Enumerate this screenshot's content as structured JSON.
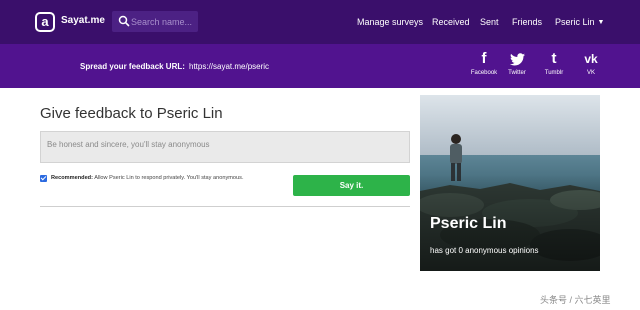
{
  "nav": {
    "brand": "Sayat.me",
    "search_placeholder": "Search name...",
    "links": {
      "manage_surveys": "Manage surveys",
      "received": "Received",
      "sent": "Sent",
      "friends": "Friends",
      "user": "Pseric Lin"
    }
  },
  "share": {
    "label": "Spread your feedback URL:",
    "url": "https://sayat.me/pseric",
    "networks": [
      {
        "label": "Facebook",
        "icon": "facebook-icon"
      },
      {
        "label": "Twitter",
        "icon": "twitter-icon"
      },
      {
        "label": "Tumblr",
        "icon": "tumblr-icon"
      },
      {
        "label": "VK",
        "icon": "vk-icon"
      }
    ]
  },
  "form": {
    "title": "Give feedback to Pseric Lin",
    "feedback_value": "",
    "feedback_placeholder": "Be honest and sincere, you'll stay anonymous",
    "recommended_checked": true,
    "recommended_bold": "Recommended:",
    "recommended_text": "Allow Pseric Lin to respond privately. You'll stay anonymous.",
    "submit_label": "Say it."
  },
  "profile": {
    "name": "Pseric Lin",
    "subtitle": "has got 0 anonymous opinions"
  },
  "watermark": "头条号 / 六七英里",
  "colors": {
    "nav_bg": "#3a0f6b",
    "share_bg": "#51138f",
    "button_green": "#2db349",
    "checkbox_blue": "#2b6ae0"
  }
}
